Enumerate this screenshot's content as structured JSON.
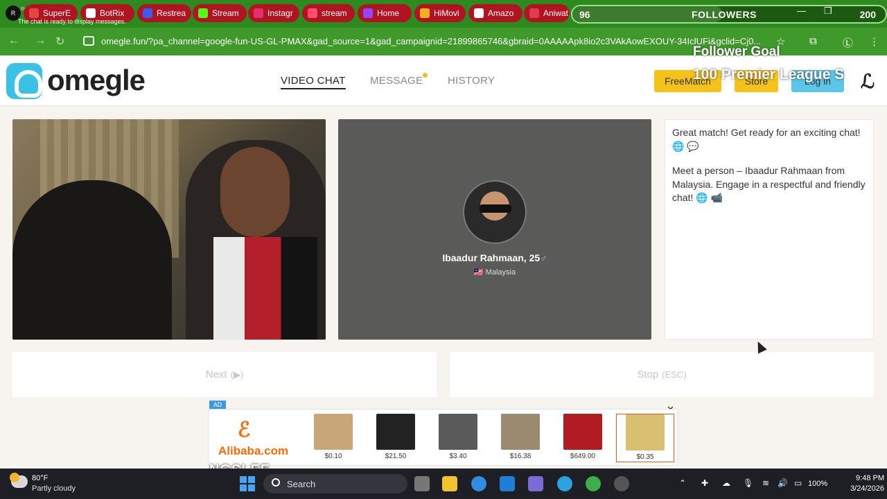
{
  "browser": {
    "tabs": [
      {
        "label": "SuperE",
        "color": "#e64545"
      },
      {
        "label": "BotRix",
        "color": "#ffffff"
      },
      {
        "label": "Restrea",
        "color": "#3c5cf0"
      },
      {
        "label": "Stream",
        "color": "#53fc18"
      },
      {
        "label": "Instagr",
        "color": "#e1306c"
      },
      {
        "label": "stream",
        "color": "#ff4d6d"
      },
      {
        "label": "Home",
        "color": "#9146ff"
      },
      {
        "label": "HiMovi",
        "color": "#f2b01e"
      },
      {
        "label": "Amazo",
        "color": "#ffffff"
      },
      {
        "label": "Aniwat",
        "color": "#e03c50"
      }
    ],
    "url": "omegle.fun/?pa_channel=google-fun-US-GL-PMAX&gad_source=1&gad_campaignid=21899865746&gbraid=0AAAAApk8io2c3VAkAowEXOUY-34IclUFi&gclid=Cj0..."
  },
  "overlay": {
    "chat_ready": "The chat is ready to display messages.",
    "followers_count": "96",
    "followers_label": "FOLLOWERS",
    "followers_goal": "200",
    "followers_progress": 0.48,
    "goal_title": "Follower Goal",
    "goal_line": "100 Premier League S",
    "bottom_text": "NGSLEE"
  },
  "site": {
    "logo": "omegle",
    "nav": {
      "video_chat": "VIDEO CHAT",
      "message": "MESSAGE",
      "history": "HISTORY"
    },
    "buttons": {
      "freematch": "FreeMatch",
      "store": "Store",
      "login": "Log in"
    }
  },
  "partner": {
    "name": "Ibaadur Rahmaan, 25",
    "gender_icon": "♂",
    "country": "Malaysia",
    "flag": "🇲🇾"
  },
  "chat": {
    "message1": "Great match! Get ready for an exciting chat! 🌐 💬",
    "message2": "Meet a person – Ibaadur Rahmaan from Malaysia. Engage in a respectful and friendly chat! 🌐 📹"
  },
  "actions": {
    "next": "Next",
    "next_hint": "(▶)",
    "stop": "Stop",
    "stop_hint": "(ESC)"
  },
  "ad": {
    "tag": "AD",
    "brand": "Alibaba.com",
    "products": [
      {
        "price": "$0.10",
        "color": "#c8a677"
      },
      {
        "price": "$21.50",
        "color": "#222222"
      },
      {
        "price": "$3.40",
        "color": "#5a5a5a"
      },
      {
        "price": "$16.38",
        "color": "#9a8a70"
      },
      {
        "price": "$649.00",
        "color": "#b01c20"
      },
      {
        "price": "$0.35",
        "color": "#d9c070"
      }
    ]
  },
  "taskbar": {
    "temperature": "80°F",
    "condition": "Partly cloudy",
    "search_placeholder": "Search",
    "battery": "100%",
    "time": "9:48 PM",
    "date": "3/24/2026"
  }
}
